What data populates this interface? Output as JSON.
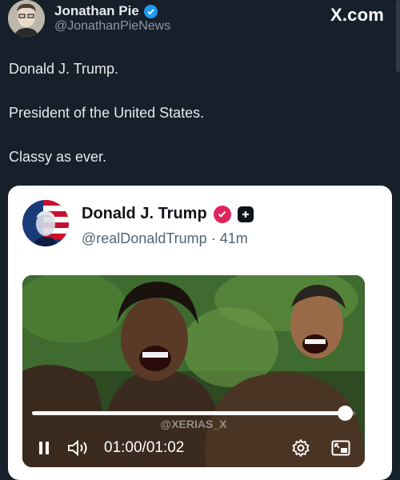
{
  "post": {
    "author_name": "Jonathan Pie",
    "author_handle": "@JonathanPieNews",
    "source_label": "X.com",
    "text_lines": [
      "Donald J. Trump.",
      "President of the United States.",
      "Classy as ever."
    ]
  },
  "quoted": {
    "author_name": "Donald J. Trump",
    "author_handle": "@realDonaldTrump",
    "separator": "·",
    "age": "41m",
    "video": {
      "watermark": "@XERIAS_X",
      "current_time": "01:00",
      "duration": "01:02",
      "progress": 0.968
    }
  },
  "colors": {
    "background": "#15202b",
    "verified_blue": "#1d9bf0",
    "verified_pink": "#e0245e"
  },
  "icons": {
    "verified": "blue-check-badge",
    "quoted_verified": "pink-check-badge",
    "affiliate": "plus-square",
    "pause": "pause-icon",
    "volume": "speaker-icon",
    "settings": "gear-icon",
    "pip": "picture-in-picture-icon"
  }
}
